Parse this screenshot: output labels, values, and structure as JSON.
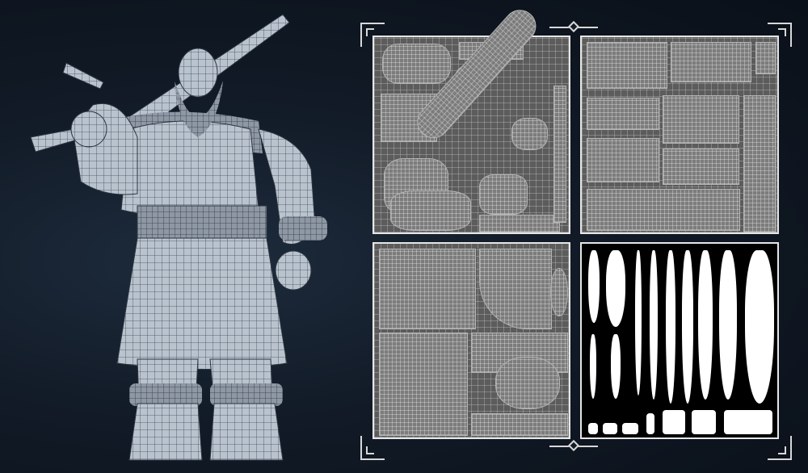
{
  "scene": {
    "background_color": "#111a26",
    "character": {
      "subject": "armored-warrior",
      "display": "wireframe-render"
    },
    "texture_panels": [
      {
        "id": "uv-armor-sword",
        "type": "uv-layout"
      },
      {
        "id": "uv-cloth",
        "type": "uv-layout"
      },
      {
        "id": "uv-body-head",
        "type": "uv-layout"
      },
      {
        "id": "hair-cards",
        "type": "alpha-mask"
      }
    ],
    "frame_color": "#e6e6e6",
    "uv_background": "#5c5c5c",
    "hair_background": "#000000"
  }
}
